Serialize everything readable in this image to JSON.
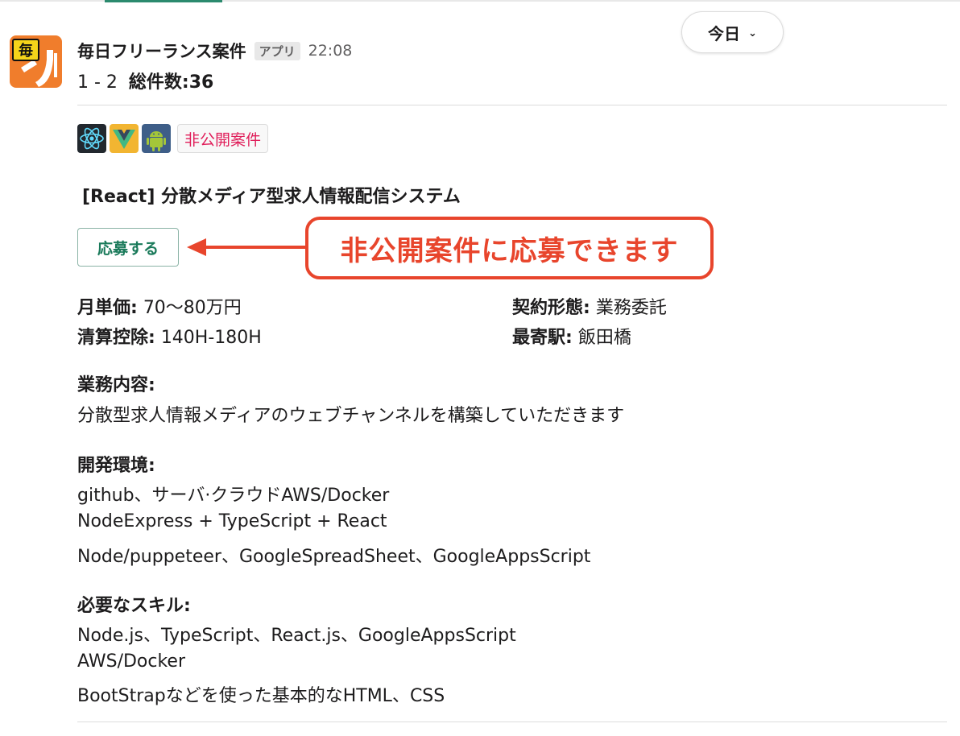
{
  "header": {
    "date_pill_label": "今日",
    "sender_name": "毎日フリーランス案件",
    "app_badge": "アプリ",
    "time": "22:08",
    "range": "1 - 2",
    "total_label": "総件数:36",
    "avatar_text": "毎"
  },
  "tags": {
    "icons": [
      "react-icon",
      "vue-icon",
      "android-icon"
    ],
    "private_badge": "非公開案件"
  },
  "job": {
    "title": "[React] 分散メディア型求人情報配信システム",
    "apply_button": "応募する",
    "callout_text": "非公開案件に応募できます",
    "price_label": "月単価:",
    "price_value": "70〜80万円",
    "contract_label": "契約形態:",
    "contract_value": "業務委託",
    "settlement_label": "清算控除:",
    "settlement_value": "140H-180H",
    "station_label": "最寄駅:",
    "station_value": "飯田橋",
    "description_label": "業務内容:",
    "description_lines": [
      "分散型求人情報メディアのウェブチャンネルを構築していただきます"
    ],
    "environment_label": "開発環境:",
    "environment_lines": [
      "github、サーバ·クラウドAWS/Docker",
      "NodeExpress + TypeScript + React",
      "Node/puppeteer、GoogleSpreadSheet、GoogleAppsScript"
    ],
    "skills_label": "必要なスキル:",
    "skills_lines": [
      "Node.js、TypeScript、React.js、GoogleAppsScript",
      "AWS/Docker",
      "BootStrapなどを使った基本的なHTML、CSS"
    ]
  },
  "colors": {
    "accent_green": "#1a7a5a",
    "callout_red": "#e8452c",
    "private_badge_text": "#e01e5a",
    "avatar_orange": "#f07d2c"
  }
}
